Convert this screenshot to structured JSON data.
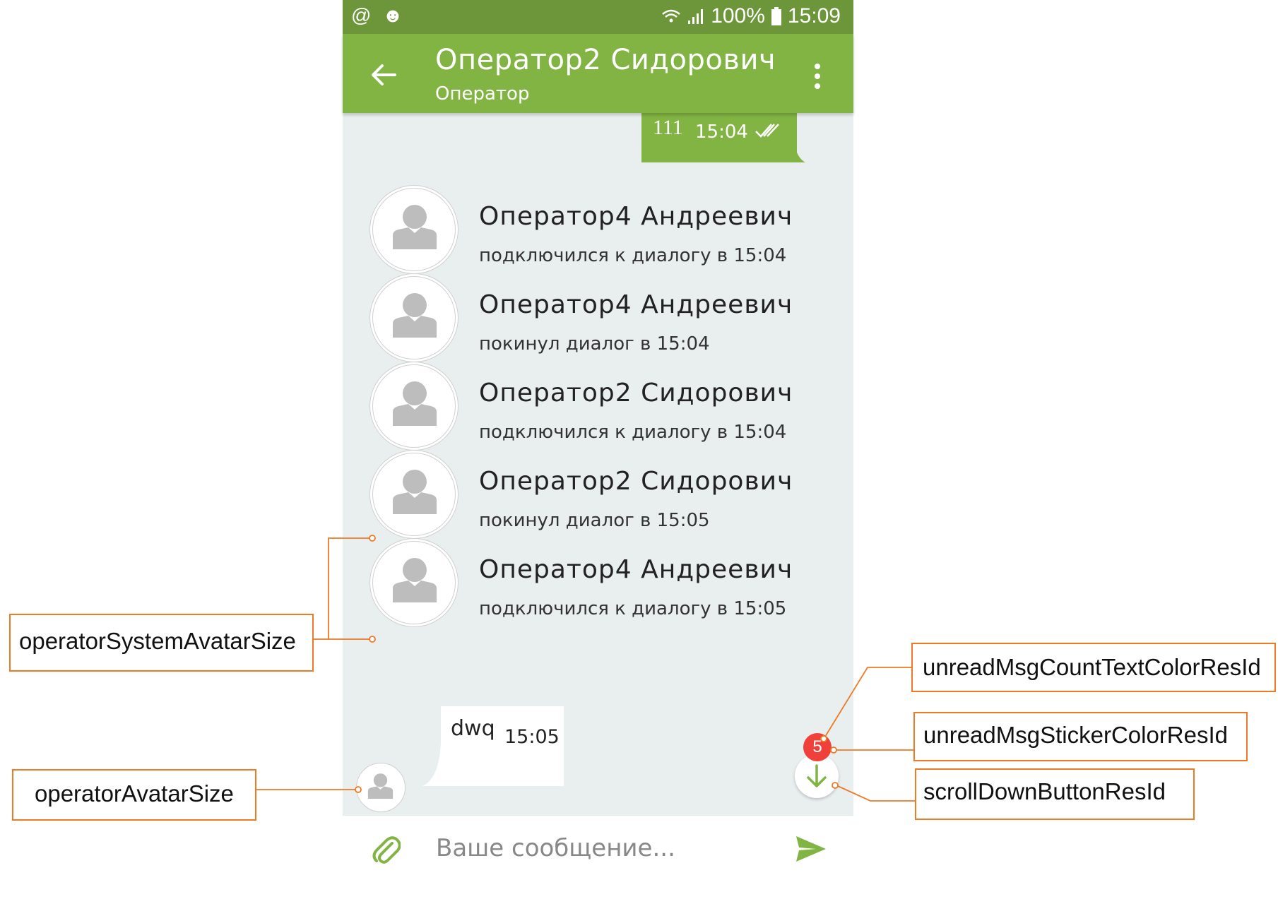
{
  "status_bar": {
    "left_icons": "@ ☻",
    "battery": "100%",
    "time": "15:09"
  },
  "app_bar": {
    "title": "Оператор2 Сидорович",
    "subtitle": "Оператор"
  },
  "outgoing_message": {
    "text": "111",
    "time": "15:04"
  },
  "system_messages": [
    {
      "name": "Оператор4 Андреевич",
      "text": "подключился к диалогу в 15:04"
    },
    {
      "name": "Оператор4 Андреевич",
      "text": "покинул диалог в 15:04"
    },
    {
      "name": "Оператор2 Сидорович",
      "text": "подключился к диалогу в 15:04"
    },
    {
      "name": "Оператор2 Сидорович",
      "text": "покинул диалог в 15:05"
    },
    {
      "name": "Оператор4 Андреевич",
      "text": "подключился к диалогу в 15:05"
    }
  ],
  "incoming_message": {
    "text": "dwq",
    "time": "15:05"
  },
  "unread_count": "5",
  "input": {
    "placeholder": "Ваше сообщение..."
  },
  "callouts": {
    "operator_system_avatar_size": "operatorSystemAvatarSize",
    "operator_avatar_size": "operatorAvatarSize",
    "unread_msg_count_text_color": "unreadMsgCountTextColorResId",
    "unread_msg_sticker_color": "unreadMsgStickerColorResId",
    "scroll_down_button": "scrollDownButtonResId"
  },
  "colors": {
    "status_bar": "#6d963a",
    "app_bar": "#82b443",
    "chat_background": "#e9eeee",
    "badge": "#f0403a",
    "callout_border": "#ef7a23"
  }
}
